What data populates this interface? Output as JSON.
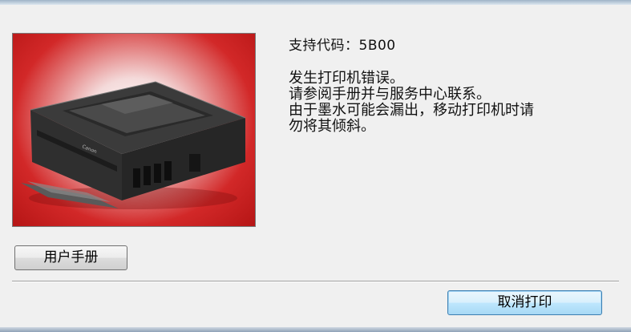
{
  "dialog": {
    "support_code": "支持代码：5B00",
    "message_lines": [
      "发生打印机错误。",
      "请参阅手册并与服务中心联系。",
      "由于墨水可能会漏出，移动打印机时请",
      "勿将其倾斜。"
    ]
  },
  "buttons": {
    "manual_label": "用户手册",
    "cancel_print_label": "取消打印"
  },
  "image": {
    "subject": "printer-illustration",
    "printed_brand": "Canon",
    "background_color": "#cc1f1f"
  }
}
